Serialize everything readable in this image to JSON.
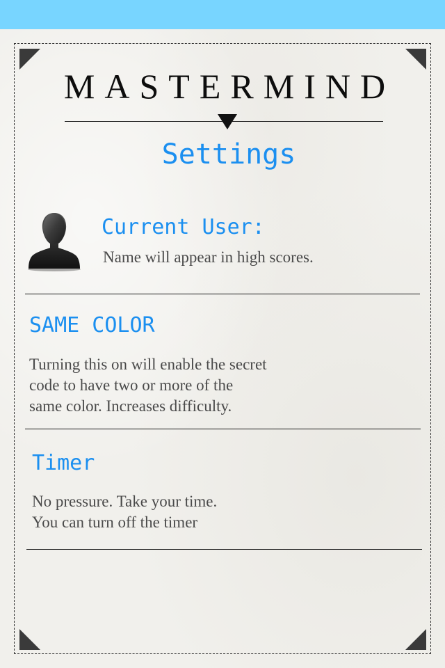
{
  "app": {
    "title": "MASTERMIND"
  },
  "page": {
    "title": "Settings"
  },
  "current_user": {
    "label": "Current User:",
    "description": "Name will appear in high scores.",
    "icon": "user-silhouette-icon"
  },
  "same_color": {
    "label": "SAME COLOR",
    "description_lines": [
      "Turning this on will enable the secret",
      "code to have two or more of the",
      "same color. Increases difficulty."
    ]
  },
  "timer": {
    "label": "Timer",
    "description_lines": [
      "No pressure. Take your time.",
      "You can turn off the timer"
    ]
  },
  "colors": {
    "accent": "#1b8ff0",
    "status_bar": "#78d5ff",
    "paper": "#f1f0ec",
    "ink": "#0d0d0d"
  }
}
